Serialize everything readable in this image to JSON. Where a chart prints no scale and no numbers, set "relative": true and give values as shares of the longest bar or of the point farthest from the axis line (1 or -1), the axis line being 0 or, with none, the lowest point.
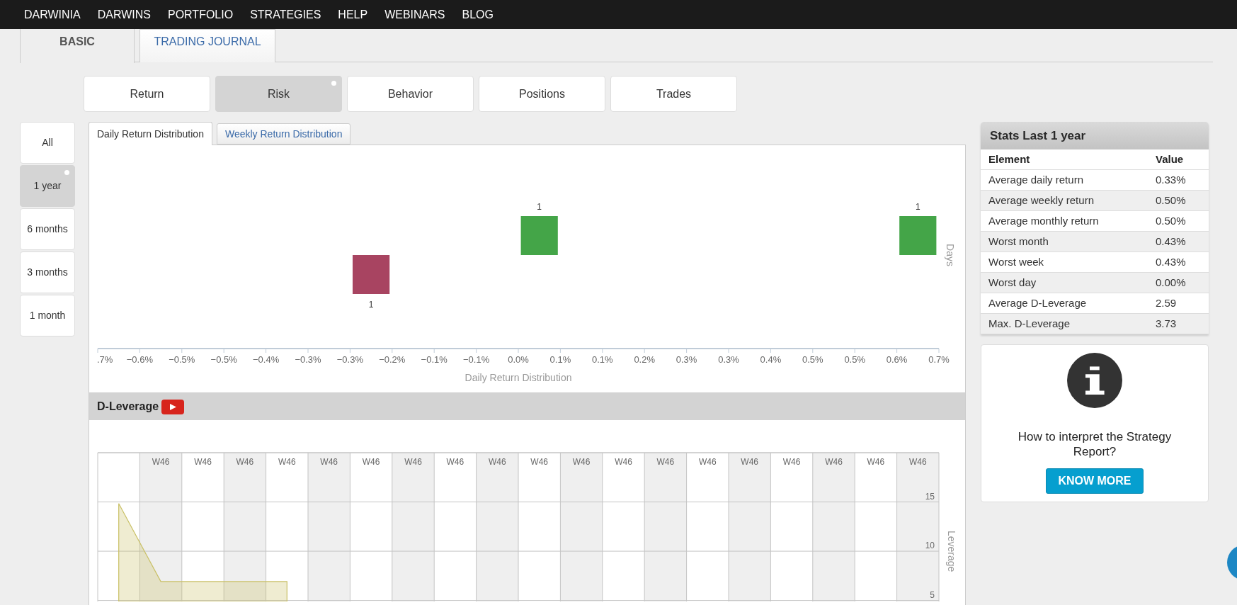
{
  "top_nav": [
    "DARWINIA",
    "DARWINS",
    "PORTFOLIO",
    "STRATEGIES",
    "HELP",
    "WEBINARS",
    "BLOG"
  ],
  "page_tabs": [
    {
      "label": "BASIC",
      "selected": true
    },
    {
      "label": "TRADING JOURNAL",
      "selected": false
    }
  ],
  "section_tabs": [
    {
      "label": "Return",
      "selected": false
    },
    {
      "label": "Risk",
      "selected": true
    },
    {
      "label": "Behavior",
      "selected": false
    },
    {
      "label": "Positions",
      "selected": false
    },
    {
      "label": "Trades",
      "selected": false
    }
  ],
  "period_buttons": [
    {
      "label": "All",
      "selected": false
    },
    {
      "label": "1 year",
      "selected": true
    },
    {
      "label": "6 months",
      "selected": false
    },
    {
      "label": "3 months",
      "selected": false
    },
    {
      "label": "1 month",
      "selected": false
    }
  ],
  "distribution_panel": {
    "tabs": [
      {
        "label": "Daily Return Distribution",
        "selected": true
      },
      {
        "label": "Weekly Return Distribution",
        "selected": false
      }
    ],
    "chart_data": {
      "type": "bar",
      "relative": true,
      "xlabel": "Daily Return Distribution",
      "ylabel": "Days",
      "xlim": [
        -0.66,
        0.66
      ],
      "xticks": [
        {
          "value": -0.66,
          "label": ".7%"
        },
        {
          "value": -0.594,
          "label": "−0.6%"
        },
        {
          "value": -0.528,
          "label": "−0.5%"
        },
        {
          "value": -0.462,
          "label": "−0.5%"
        },
        {
          "value": -0.396,
          "label": "−0.4%"
        },
        {
          "value": -0.33,
          "label": "−0.3%"
        },
        {
          "value": -0.264,
          "label": "−0.3%"
        },
        {
          "value": -0.198,
          "label": "−0.2%"
        },
        {
          "value": -0.132,
          "label": "−0.1%"
        },
        {
          "value": -0.066,
          "label": "−0.1%"
        },
        {
          "value": 0,
          "label": "0.0%"
        },
        {
          "value": 0.066,
          "label": "0.1%"
        },
        {
          "value": 0.132,
          "label": "0.1%"
        },
        {
          "value": 0.198,
          "label": "0.2%"
        },
        {
          "value": 0.264,
          "label": "0.3%"
        },
        {
          "value": 0.33,
          "label": "0.3%"
        },
        {
          "value": 0.396,
          "label": "0.4%"
        },
        {
          "value": 0.462,
          "label": "0.5%"
        },
        {
          "value": 0.528,
          "label": "0.5%"
        },
        {
          "value": 0.594,
          "label": "0.6%"
        },
        {
          "value": 0.66,
          "label": "0.7%"
        }
      ],
      "x": [
        -0.231,
        0.033,
        0.627
      ],
      "series": [
        {
          "color": "#a84461",
          "values": [
            -1,
            null,
            null
          ]
        },
        {
          "color": "#44a548",
          "values": [
            null,
            1,
            1
          ]
        }
      ],
      "value_labels": [
        "1",
        "1",
        "1"
      ]
    }
  },
  "leverage_panel": {
    "title": "D-Leverage",
    "chart_data": {
      "type": "area",
      "ylabel": "Leverage",
      "ylim": [
        4.9,
        20
      ],
      "categories": [
        null,
        "W46",
        "W46",
        "W46",
        "W46",
        "W46",
        "W46",
        "W46",
        "W46",
        "W46",
        "W46",
        "W46",
        "W46",
        "W46",
        "W46",
        "W46",
        "W46",
        "W46",
        "W46",
        "W46"
      ],
      "yticks": [
        5,
        10,
        15
      ],
      "series": [
        {
          "color": "#c9c066",
          "values": [
            14.84,
            6.92,
            6.92,
            6.92,
            6.92,
            null,
            null,
            null,
            null,
            null,
            null,
            null,
            null,
            null,
            null,
            null,
            null,
            null,
            null,
            null
          ]
        }
      ]
    }
  },
  "stats_panel": {
    "title": "Stats Last 1 year",
    "columns": [
      "Element",
      "Value"
    ],
    "rows": [
      [
        "Average daily return",
        "0.33%"
      ],
      [
        "Average weekly return",
        "0.50%"
      ],
      [
        "Average monthly return",
        "0.50%"
      ],
      [
        "Worst month",
        "0.43%"
      ],
      [
        "Worst week",
        "0.43%"
      ],
      [
        "Worst day",
        "0.00%"
      ],
      [
        "Average D-Leverage",
        "2.59"
      ],
      [
        "Max. D-Leverage",
        "3.73"
      ]
    ]
  },
  "info_card": {
    "text": "How to interpret the Strategy Report?",
    "button": "KNOW MORE"
  }
}
